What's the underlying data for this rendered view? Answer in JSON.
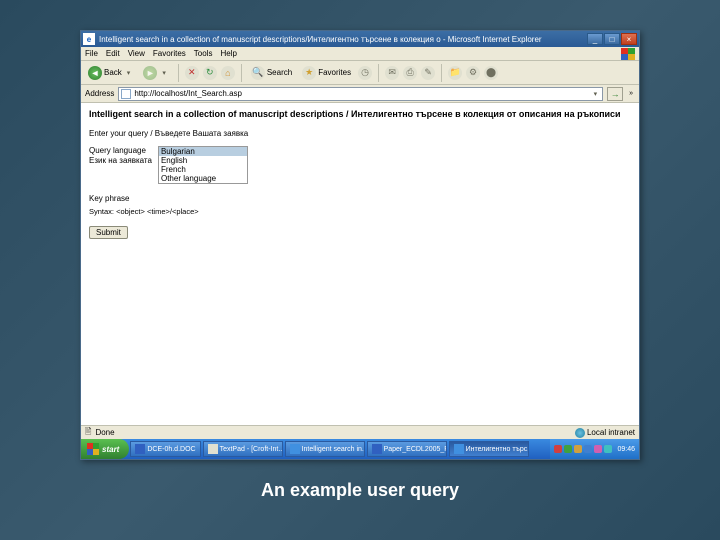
{
  "window": {
    "title": "Intelligent search in a collection of manuscript descriptions/Интелигентно търсене в колекция о - Microsoft Internet Explorer"
  },
  "menu": {
    "file": "File",
    "edit": "Edit",
    "view": "View",
    "favorites": "Favorites",
    "tools": "Tools",
    "help": "Help"
  },
  "toolbar": {
    "back_label": "Back",
    "search_label": "Search",
    "favorites_label": "Favorites"
  },
  "address": {
    "label": "Address",
    "url": "http://localhost/Int_Search.asp"
  },
  "page": {
    "heading": "Intelligent search in a collection of manuscript descriptions / Интелигентно търсене в колекция от описания на ръкописи",
    "prompt": "Enter your query / Въведете Вашата заявка",
    "query_label_en": "Query language",
    "query_label_bg": "Език на заявката",
    "lang_options": [
      "Bulgarian",
      "English",
      "French",
      "Other language"
    ],
    "key_phrase_label": "Key phrase",
    "syntax_label": "Syntax: <object> <time>/<place>",
    "submit": "Submit"
  },
  "status": {
    "done": "Done",
    "zone": "Local intranet"
  },
  "taskbar": {
    "start": "start",
    "items": [
      "DCE-0h.d.DOC",
      "TextPad - [Croft-Int...",
      "Intelligent search in...",
      "Paper_ECDL2005_Pa...",
      "Интелигентно търс..."
    ],
    "clock": "09:46"
  },
  "tray_colors": [
    "#d04040",
    "#40a040",
    "#d0a040",
    "#4080d0",
    "#d060b0",
    "#40c0c0"
  ],
  "caption": "An example user query"
}
